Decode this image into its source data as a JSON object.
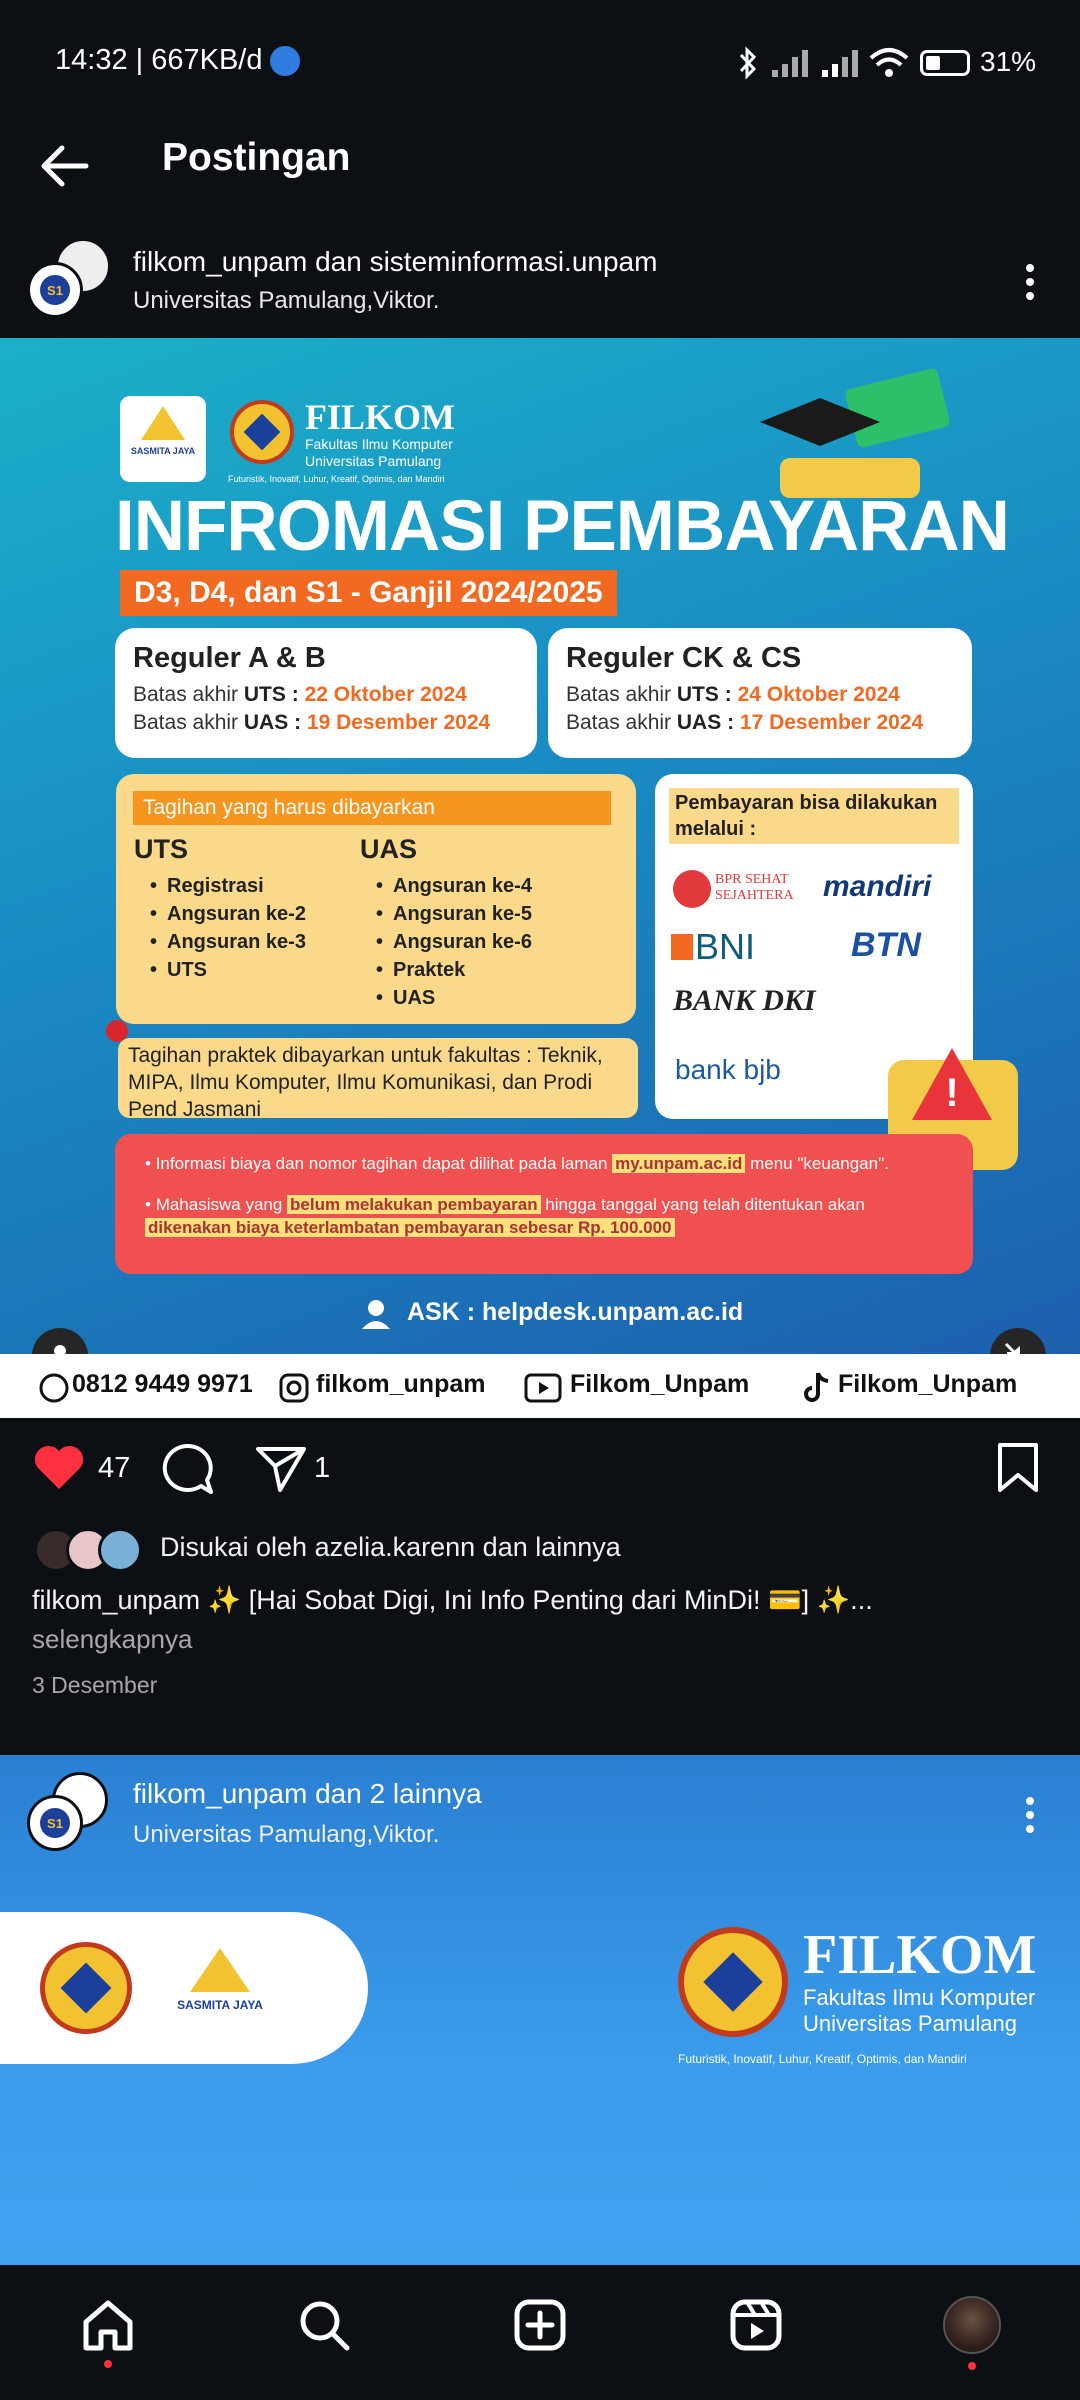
{
  "status_bar": {
    "time_data": "14:32 | 667KB/d",
    "battery": "31%"
  },
  "top_bar": {
    "title": "Postingan"
  },
  "post1": {
    "username": "filkom_unpam dan sisteminformasi.unpam",
    "location": "Universitas Pamulang,Viktor.",
    "poster": {
      "logo_left": "SASMITA JAYA",
      "logo_title": "FILKOM",
      "logo_sub1": "Fakultas Ilmu Komputer",
      "logo_sub2": "Universitas Pamulang",
      "tagline": "Futuristik, Inovatif, Luhur, Kreatif, Optimis, dan Mandiri",
      "heading": "INFROMASI PEMBAYARAN",
      "subheading": "D3, D4, dan S1 - Ganjil 2024/2025",
      "reg_ab": {
        "title": "Reguler A & B",
        "uts_prefix": "Batas akhir ",
        "uts_label": "UTS : ",
        "uts_date": "22 Oktober 2024",
        "uas_prefix": "Batas akhir ",
        "uas_label": "UAS : ",
        "uas_date": "19 Desember 2024"
      },
      "reg_ck": {
        "title": "Reguler CK & CS",
        "uts_prefix": "Batas akhir ",
        "uts_label": "UTS : ",
        "uts_date": "24 Oktober 2024",
        "uas_prefix": "Batas akhir ",
        "uas_label": "UAS : ",
        "uas_date": "17 Desember 2024"
      },
      "tagihan_title": "Tagihan yang harus dibayarkan",
      "uts_title": "UTS",
      "uts_items": [
        "Registrasi",
        "Angsuran ke-2",
        "Angsuran ke-3",
        "UTS"
      ],
      "uas_title": "UAS",
      "uas_items": [
        "Angsuran ke-4",
        "Angsuran ke-5",
        "Angsuran ke-6",
        "Praktek",
        "UAS"
      ],
      "pay_title": "Pembayaran bisa dilakukan melalui :",
      "banks": {
        "bpr": "BPR SEHAT SEJAHTERA",
        "mandiri": "mandiri",
        "bni": "BNI",
        "btn": "BTN",
        "dki": "BANK DKI",
        "bjb": "bank bjb"
      },
      "note": "Tagihan praktek dibayarkan untuk fakultas : Teknik, MIPA, Ilmu Komputer, Ilmu Komunikasi, dan Prodi Pend Jasmani",
      "info1_a": "Informasi biaya dan nomor tagihan dapat dilihat pada laman ",
      "info1_b": "my.unpam.ac.id",
      "info1_c": " menu \"keuangan\".",
      "info2_a": "Mahasiswa yang ",
      "info2_b": "belum melakukan pembayaran",
      "info2_c": " hingga tanggal yang telah ditentukan akan ",
      "info2_d": "dikenakan biaya keterlambatan pembayaran sebesar Rp. 100.000",
      "ask": "ASK : helpdesk.unpam.ac.id"
    },
    "social": {
      "phone": "0812 9449 9971",
      "instagram": "filkom_unpam",
      "youtube": "Filkom_Unpam",
      "tiktok": "Filkom_Unpam"
    },
    "likes_count": "47",
    "shares_count": "1",
    "liked_by": "Disukai oleh azelia.karenn dan lainnya",
    "caption": "filkom_unpam ✨ [Hai Sobat Digi, Ini Info Penting dari MinDi! 💳] ✨...",
    "more": "selengkapnya",
    "date": "3 Desember"
  },
  "post2": {
    "username": "filkom_unpam dan 2 lainnya",
    "location": "Universitas Pamulang,Viktor.",
    "logo_left": "SASMITA JAYA",
    "logo_title": "FILKOM",
    "logo_sub1": "Fakultas Ilmu Komputer",
    "logo_sub2": "Universitas Pamulang",
    "tagline": "Futuristik, Inovatif, Luhur, Kreatif, Optimis, dan Mandiri"
  },
  "colors": {
    "accent_orange": "#f26a21",
    "like_red": "#ff3040",
    "bg": "#0c1014"
  }
}
